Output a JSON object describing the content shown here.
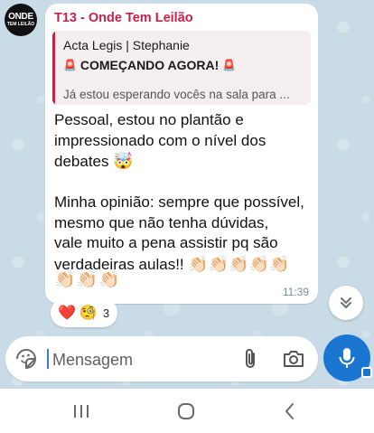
{
  "chat": {
    "avatar": {
      "line1": "ONDE",
      "line2": "TEM LEILÃO"
    },
    "message": {
      "sender": "T13 - Onde Tem Leilão",
      "reply": {
        "author": "Acta Legis | Stephanie",
        "line2": "COMEÇANDO AGORA!",
        "line3": "Já estou esperando vocês na sala para ..."
      },
      "text": "Pessoal, estou no plantão e\nimpressionado com o nível dos\ndebates",
      "text2": "Minha opinião: sempre que possível,\nmesmo que não tenha dúvidas,\nvale muito a pena assistir pq são\nverdadeiras aulas!!",
      "emoji_mindblown": "🤯",
      "claps_line1": "👏🏻👏🏻👏🏻👏🏻👏🏻",
      "claps_line2": "👏🏻👏🏻👏🏻",
      "siren": "🚨",
      "time": "11:39"
    },
    "reactions": {
      "heart": "❤️",
      "face": "🧐",
      "count": "3"
    }
  },
  "composer": {
    "placeholder": "Mensagem"
  },
  "icons": {
    "sticker": "sticker-icon",
    "attach": "paperclip-icon",
    "camera": "camera-icon",
    "mic": "microphone-icon",
    "scroll": "chevron-double-down-icon"
  },
  "colors": {
    "accent": "#c4224a",
    "mic_bg": "#1b76d2",
    "chat_bg": "#c9dbe6"
  }
}
